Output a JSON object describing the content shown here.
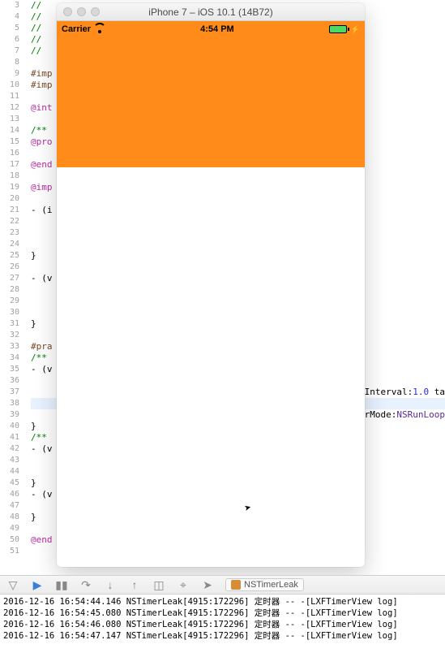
{
  "simulator": {
    "title": "iPhone 7 – iOS 10.1 (14B72)",
    "statusbar": {
      "carrier": "Carrier",
      "time": "4:54 PM"
    }
  },
  "editor": {
    "line_start": 3,
    "line_end": 51,
    "lines": {
      "3": {
        "cls": "comment",
        "text": "// "
      },
      "4": {
        "cls": "comment",
        "text": "// "
      },
      "5": {
        "cls": "comment",
        "text": "// "
      },
      "6": {
        "cls": "comment",
        "text": "// "
      },
      "7": {
        "cls": "comment",
        "text": "// "
      },
      "8": {
        "cls": "",
        "text": ""
      },
      "9": {
        "cls": "preproc",
        "text": "#imp"
      },
      "10": {
        "cls": "preproc",
        "text": "#imp"
      },
      "11": {
        "cls": "",
        "text": ""
      },
      "12": {
        "cls": "keyword",
        "text": "@int"
      },
      "13": {
        "cls": "",
        "text": ""
      },
      "14": {
        "cls": "comment",
        "text": "/** "
      },
      "15": {
        "cls": "keyword",
        "text": "@pro"
      },
      "16": {
        "cls": "",
        "text": ""
      },
      "17": {
        "cls": "keyword",
        "text": "@end"
      },
      "18": {
        "cls": "",
        "text": ""
      },
      "19": {
        "cls": "keyword",
        "text": "@imp"
      },
      "20": {
        "cls": "",
        "text": ""
      },
      "21": {
        "cls": "",
        "text": "- (i"
      },
      "22": {
        "cls": "",
        "text": ""
      },
      "23": {
        "cls": "",
        "text": ""
      },
      "24": {
        "cls": "",
        "text": ""
      },
      "25": {
        "cls": "",
        "text": "}"
      },
      "26": {
        "cls": "",
        "text": ""
      },
      "27": {
        "cls": "",
        "text": "- (v"
      },
      "28": {
        "cls": "",
        "text": ""
      },
      "29": {
        "cls": "",
        "text": ""
      },
      "30": {
        "cls": "",
        "text": ""
      },
      "31": {
        "cls": "",
        "text": "}"
      },
      "32": {
        "cls": "",
        "text": ""
      },
      "33": {
        "cls": "preproc",
        "text": "#pra"
      },
      "34": {
        "cls": "comment",
        "text": "/** "
      },
      "35": {
        "cls": "",
        "text": "- (v"
      },
      "36": {
        "cls": "",
        "text": ""
      },
      "37": {
        "cls": "",
        "text": ""
      },
      "38": {
        "cls": "",
        "text": ""
      },
      "39": {
        "cls": "",
        "text": ""
      },
      "40": {
        "cls": "",
        "text": "}"
      },
      "41": {
        "cls": "comment",
        "text": "/** "
      },
      "42": {
        "cls": "",
        "text": "- (v"
      },
      "43": {
        "cls": "",
        "text": ""
      },
      "44": {
        "cls": "",
        "text": ""
      },
      "45": {
        "cls": "",
        "text": "}"
      },
      "46": {
        "cls": "",
        "text": "- (v"
      },
      "47": {
        "cls": "",
        "text": ""
      },
      "48": {
        "cls": "",
        "text": "}"
      },
      "49": {
        "cls": "",
        "text": ""
      },
      "50": {
        "cls": "keyword",
        "text": "@end"
      },
      "51": {
        "cls": "",
        "text": ""
      }
    },
    "right_fragments": {
      "37": "Interval:1.0 ta",
      "39": "rMode:NSRunLoop"
    }
  },
  "debugbar": {
    "breadcrumb": "NSTimerLeak"
  },
  "console": {
    "lines": [
      "2016-12-16 16:54:44.146 NSTimerLeak[4915:172296] 定时器 -- -[LXFTimerView log]",
      "2016-12-16 16:54:45.080 NSTimerLeak[4915:172296] 定时器 -- -[LXFTimerView log]",
      "2016-12-16 16:54:46.080 NSTimerLeak[4915:172296] 定时器 -- -[LXFTimerView log]",
      "2016-12-16 16:54:47.147 NSTimerLeak[4915:172296] 定时器 -- -[LXFTimerView log]"
    ]
  }
}
